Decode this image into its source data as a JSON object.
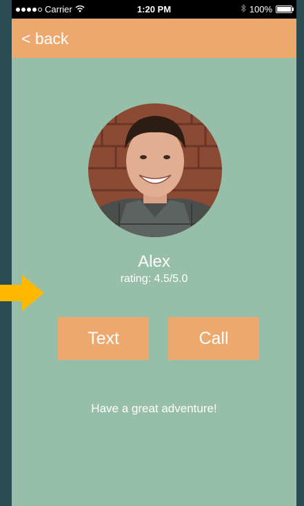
{
  "status_bar": {
    "carrier": "Carrier",
    "time": "1:20 PM",
    "battery": "100%"
  },
  "nav": {
    "back_label": "< back"
  },
  "profile": {
    "name": "Alex",
    "rating": "rating: 4.5/5.0"
  },
  "actions": {
    "text_label": "Text",
    "call_label": "Call"
  },
  "message": "Have a great adventure!",
  "colors": {
    "background": "#97bea8",
    "accent": "#eda86e",
    "frame": "#2c4a52",
    "arrow": "#ffb800"
  }
}
